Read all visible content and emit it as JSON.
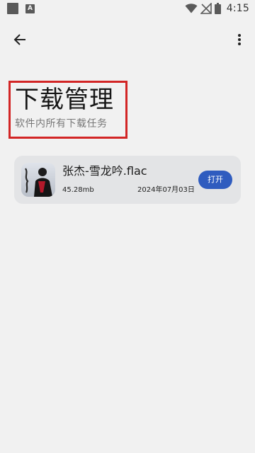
{
  "status_bar": {
    "time": "4:15",
    "icons": [
      "square-icon",
      "a-notification-icon",
      "wifi-icon",
      "signal-off-icon",
      "battery-icon"
    ]
  },
  "app_bar": {
    "back_icon": "back-arrow-icon",
    "menu_icon": "more-vert-icon"
  },
  "header": {
    "title": "下载管理",
    "subtitle": "软件内所有下载任务"
  },
  "downloads": [
    {
      "file_name": "张杰-雪龙吟.flac",
      "size": "45.28mb",
      "date": "2024年07月03日",
      "action_label": "打开"
    }
  ],
  "colors": {
    "background": "#f1f1f1",
    "card": "#e3e4e6",
    "accent": "#2f5cbf",
    "highlight": "#d22525"
  }
}
